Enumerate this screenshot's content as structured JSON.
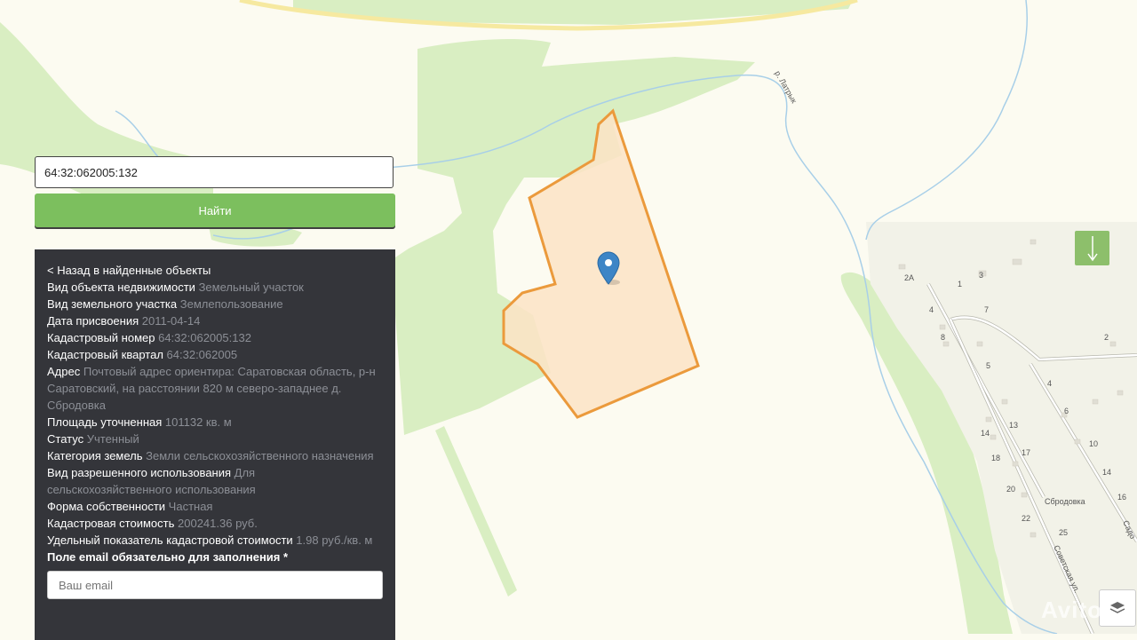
{
  "search": {
    "value": "64:32:062005:132",
    "button_label": "Найти",
    "email_placeholder": "Ваш email"
  },
  "panel": {
    "back_label": "< Назад в найденные объекты",
    "fields": [
      {
        "label": "Вид объекта недвижимости",
        "value": "Земельный участок"
      },
      {
        "label": "Вид земельного участка",
        "value": "Землепользование"
      },
      {
        "label": "Дата присвоения",
        "value": "2011-04-14"
      },
      {
        "label": "Кадастровый номер",
        "value": "64:32:062005:132"
      },
      {
        "label": "Кадастровый квартал",
        "value": "64:32:062005"
      },
      {
        "label": "Адрес",
        "value": "Почтовый адрес ориентира: Саратовская область, р-н Саратовский, на расстоянии 820 м северо-западнее д. Сбродовка"
      },
      {
        "label": "Площадь уточненная",
        "value": "101132 кв. м"
      },
      {
        "label": "Статус",
        "value": "Учтенный"
      },
      {
        "label": "Категория земель",
        "value": "Земли сельскохозяйственного назначения"
      },
      {
        "label": "Вид разрешенного использования",
        "value": "Для сельскохозяйственного использования"
      },
      {
        "label": "Форма собственности",
        "value": "Частная"
      },
      {
        "label": "Кадастровая стоимость",
        "value": "200241.36 руб."
      },
      {
        "label": "Удельный показатель кадастровой стоимости",
        "value": "1.98 руб./кв. м"
      }
    ],
    "email_label": "Поле email обязательно для заполнения *"
  },
  "map": {
    "river_label": "р. Латрык",
    "village_label": "Сбродовка",
    "street_label": "Советская ул.",
    "street2_label": "Садо",
    "house_numbers": [
      "2А",
      "1",
      "3",
      "4",
      "7",
      "8",
      "2",
      "5",
      "4",
      "6",
      "10",
      "14",
      "13",
      "17",
      "18",
      "14",
      "20",
      "22",
      "25",
      "16"
    ],
    "colors": {
      "land": "#fcfbf1",
      "forest": "#d9eec2",
      "river": "#a8cfe8",
      "parcel_fill": "#fbe3c6",
      "parcel_stroke": "#eb9a3c",
      "marker": "#3d85c6",
      "road_yellow": "#f6e9a0"
    }
  },
  "controls": {
    "arrow_icon": "arrow-down-icon",
    "layers_icon": "layers-icon"
  },
  "watermark": "Avito"
}
